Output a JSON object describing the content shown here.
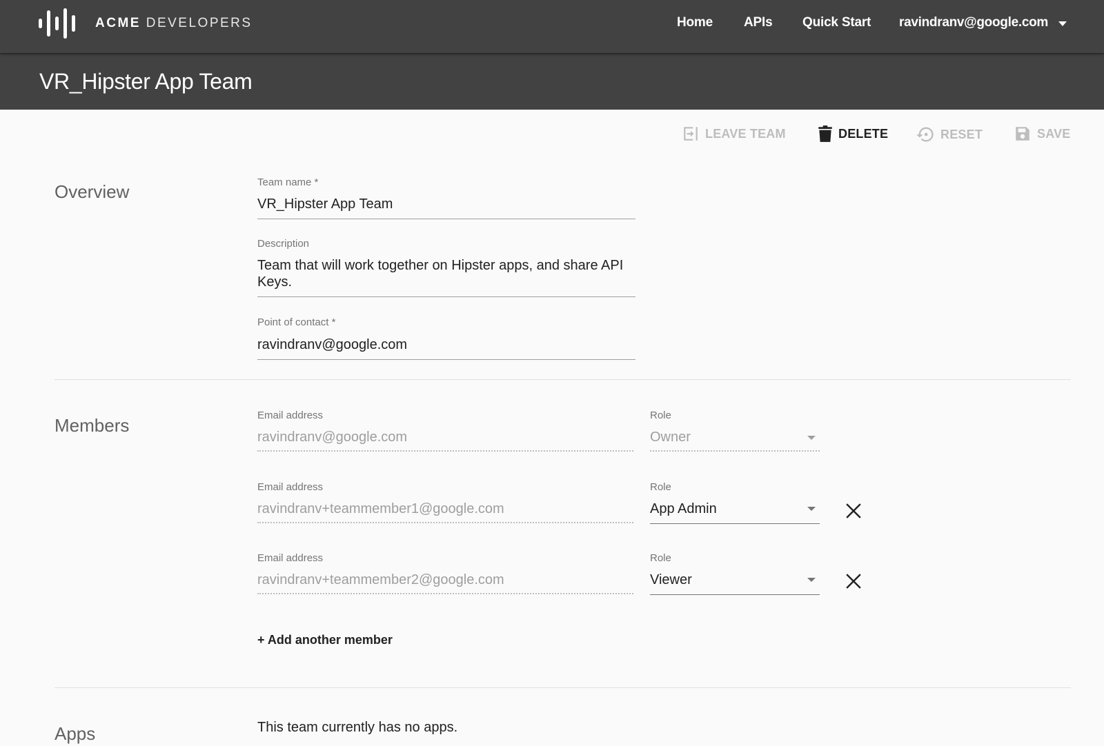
{
  "header": {
    "brand_primary": "ACME",
    "brand_secondary": "DEVELOPERS",
    "nav": {
      "home": "Home",
      "apis": "APIs",
      "quick_start": "Quick Start"
    },
    "account_email": "ravindranv@google.com"
  },
  "page_title": "VR_Hipster App Team",
  "toolbar": {
    "leave_team": "LEAVE TEAM",
    "delete": "DELETE",
    "reset": "RESET",
    "save": "SAVE"
  },
  "overview": {
    "section_label": "Overview",
    "team_name_label": "Team name *",
    "team_name_value": "VR_Hipster App Team",
    "description_label": "Description",
    "description_value": "Team that will work together on Hipster apps, and share API Keys.",
    "poc_label": "Point of contact *",
    "poc_value": "ravindranv@google.com"
  },
  "members": {
    "section_label": "Members",
    "rows": [
      {
        "email_label": "Email address",
        "email": "ravindranv@google.com",
        "role_label": "Role",
        "role": "Owner",
        "removable": false
      },
      {
        "email_label": "Email address",
        "email": "ravindranv+teammember1@google.com",
        "role_label": "Role",
        "role": "App Admin",
        "removable": true
      },
      {
        "email_label": "Email address",
        "email": "ravindranv+teammember2@google.com",
        "role_label": "Role",
        "role": "Viewer",
        "removable": true
      }
    ],
    "add_member": "+ Add another member"
  },
  "apps": {
    "section_label": "Apps",
    "empty_text": "This team currently has no apps."
  },
  "icons": {
    "logo": "acme-bars-logo-icon",
    "account_caret": "chevron-down-icon",
    "leave_team": "exit-to-app-icon",
    "delete": "trash-icon",
    "reset": "restore-icon",
    "save": "floppy-disk-icon",
    "remove_member": "close-icon"
  },
  "colors": {
    "header_bg": "#424242",
    "page_bg": "#fafafa",
    "disabled_action": "#bdbdbd",
    "primary_text": "#212121"
  }
}
